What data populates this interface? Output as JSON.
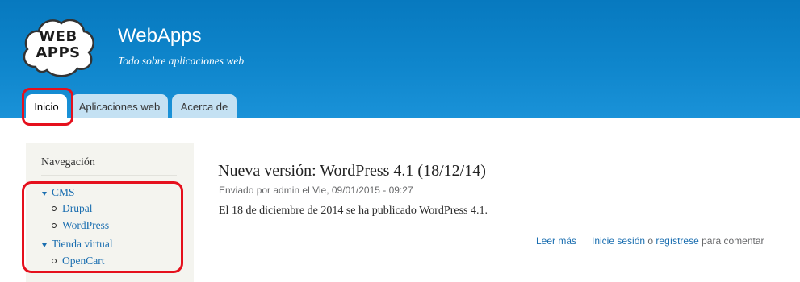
{
  "site": {
    "logo_line1": "WEB",
    "logo_line2": "APPS",
    "name": "WebApps",
    "slogan": "Todo sobre aplicaciones web"
  },
  "tabs": [
    {
      "label": "Inicio",
      "active": true
    },
    {
      "label": "Aplicaciones web",
      "active": false
    },
    {
      "label": "Acerca de",
      "active": false
    }
  ],
  "sidebar": {
    "title": "Navegación",
    "items": [
      {
        "label": "CMS",
        "expanded": true,
        "children": [
          {
            "label": "Drupal"
          },
          {
            "label": "WordPress"
          }
        ]
      },
      {
        "label": "Tienda virtual",
        "expanded": true,
        "children": [
          {
            "label": "OpenCart"
          }
        ]
      }
    ]
  },
  "post": {
    "title": "Nueva versión: WordPress 4.1 (18/12/14)",
    "submitted": "Enviado por admin el Vie, 09/01/2015 - 09:27",
    "body": "El 18 de diciembre de 2014 se ha publicado WordPress 4.1.",
    "read_more": "Leer más",
    "login": "Inicie sesión",
    "or": "o",
    "register": "regístrese",
    "to_comment": "para comentar"
  },
  "colors": {
    "header_blue": "#0f86cc",
    "tab_inactive": "#c4e1f3",
    "link": "#1a6eb0",
    "highlight_red": "#e5101d",
    "sidebar_bg": "#f4f4ef"
  }
}
